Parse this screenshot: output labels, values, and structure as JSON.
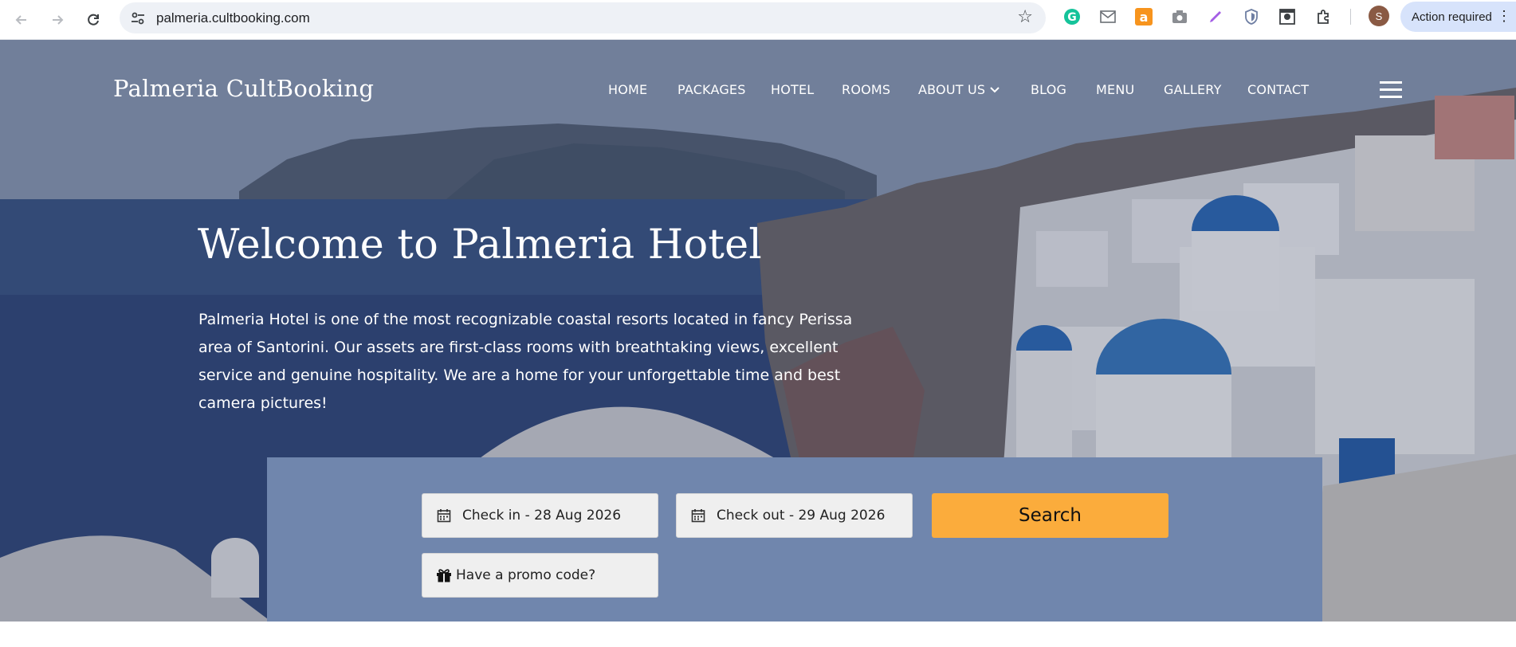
{
  "browser": {
    "url": "palmeria.cultbooking.com",
    "profile_initial": "S",
    "action_required_label": "Action required",
    "extension_icons": [
      "grammarly-icon",
      "mail-icon",
      "amazon-icon",
      "camera-icon",
      "pen-icon",
      "shield-icon",
      "screenshot-icon",
      "puzzle-icon"
    ]
  },
  "site": {
    "brand": "Palmeria CultBooking",
    "nav": [
      {
        "label": "HOME"
      },
      {
        "label": "PACKAGES"
      },
      {
        "label": "HOTEL"
      },
      {
        "label": "ROOMS"
      },
      {
        "label": "ABOUT US",
        "has_dropdown": true
      },
      {
        "label": "BLOG"
      },
      {
        "label": "MENU"
      },
      {
        "label": "GALLERY"
      },
      {
        "label": "CONTACT"
      }
    ]
  },
  "hero": {
    "title": "Welcome to Palmeria Hotel",
    "description": "Palmeria Hotel is one of the most recognizable coastal resorts located in fancy Perissa area of Santorini. Our assets are first-class rooms with breathtaking views, excellent service and genuine hospitality. We are a home for your unforgettable time and best camera pictures!"
  },
  "booking": {
    "check_in": "Check in - 28 Aug 2026",
    "check_out": "Check out - 29 Aug 2026",
    "search_label": "Search",
    "promo_label": "Have a promo code?"
  },
  "colors": {
    "booking_panel": "#7086ad",
    "search_button": "#fbac3c",
    "field_background": "#efefef",
    "action_pill": "#d7e3fb"
  }
}
